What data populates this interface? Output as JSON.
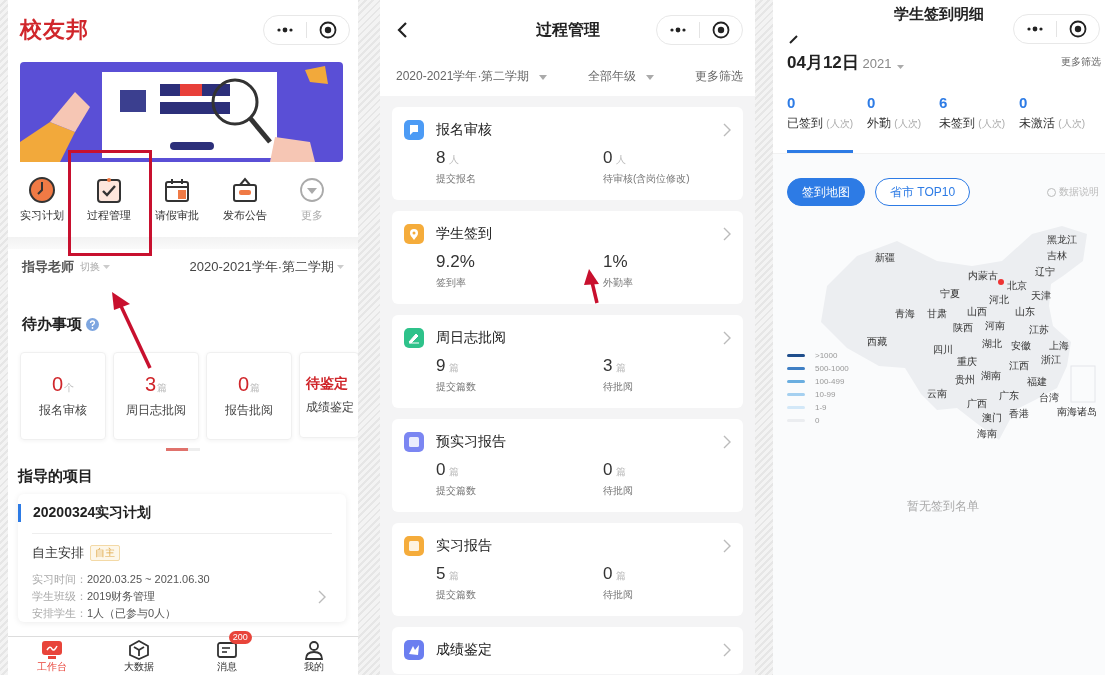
{
  "home": {
    "app_title": "校友邦",
    "shortcuts": [
      {
        "kind": "clock",
        "label": "实习计划",
        "disabled": false
      },
      {
        "kind": "check",
        "label": "过程管理",
        "disabled": false
      },
      {
        "kind": "calendar",
        "label": "请假审批",
        "disabled": false
      },
      {
        "kind": "board",
        "label": "发布公告",
        "disabled": false
      },
      {
        "kind": "more",
        "label": "更多",
        "disabled": true
      }
    ],
    "role": {
      "label": "指导老师",
      "switch": "切换"
    },
    "term": "2020-2021学年·第二学期",
    "todo": {
      "title": "待办事项",
      "cards": [
        {
          "value": "0",
          "unit": "个",
          "label": "报名审核"
        },
        {
          "value": "3",
          "unit": "篇",
          "label": "周日志批阅"
        },
        {
          "value": "0",
          "unit": "篇",
          "label": "报告批阅"
        },
        {
          "value": "待鉴定",
          "label": "成绩鉴定"
        }
      ]
    },
    "projects": {
      "title": "指导的项目",
      "card": {
        "title": "20200324实习计划",
        "mode": "自主安排",
        "tag": "自主",
        "details": [
          {
            "label": "实习时间：",
            "value": "2020.03.25 ~ 2021.06.30"
          },
          {
            "label": "学生班级：",
            "value": "2019财务管理"
          },
          {
            "label": "安排学生：",
            "value": "1人（已参与0人）"
          }
        ]
      }
    },
    "tab_bar": [
      {
        "kind": "desk",
        "label": "工作台",
        "selected": true
      },
      {
        "kind": "cube",
        "label": "大数据",
        "selected": false
      },
      {
        "kind": "message",
        "label": "消息",
        "selected": false,
        "badge": "200"
      },
      {
        "kind": "person",
        "label": "我的",
        "selected": false
      }
    ]
  },
  "process": {
    "title": "过程管理",
    "filters": [
      {
        "label": "2020-2021学年·第二学期",
        "dropdown": true
      },
      {
        "label": "全部年级",
        "dropdown": true
      },
      {
        "label": "更多筛选",
        "dropdown": false
      }
    ],
    "cards": [
      {
        "kind": "flag",
        "color": "#4c9bf5",
        "title": "报名审核",
        "stats": [
          {
            "value": "8",
            "unit": "人",
            "label": "提交报名"
          },
          {
            "value": "0",
            "unit": "人",
            "label": "待审核(含岗位修改)"
          }
        ]
      },
      {
        "kind": "pin",
        "color": "#f5ac3b",
        "title": "学生签到",
        "stats": [
          {
            "value": "9.2%",
            "label": "签到率"
          },
          {
            "value": "1%",
            "label": "外勤率"
          }
        ]
      },
      {
        "kind": "pen",
        "color": "#2ec28a",
        "title": "周日志批阅",
        "stats": [
          {
            "value": "9",
            "unit": "篇",
            "label": "提交篇数"
          },
          {
            "value": "3",
            "unit": "篇",
            "label": "待批阅"
          }
        ]
      },
      {
        "kind": "doc",
        "color": "#7b86f2",
        "title": "预实习报告",
        "stats": [
          {
            "value": "0",
            "unit": "篇",
            "label": "提交篇数"
          },
          {
            "value": "0",
            "unit": "篇",
            "label": "待批阅"
          }
        ]
      },
      {
        "kind": "doc",
        "color": "#f5ac3b",
        "title": "实习报告",
        "stats": [
          {
            "value": "5",
            "unit": "篇",
            "label": "提交篇数"
          },
          {
            "value": "0",
            "unit": "篇",
            "label": "待批阅"
          }
        ]
      },
      {
        "kind": "rank",
        "color": "#6b7ef0",
        "title": "成绩鉴定"
      }
    ]
  },
  "signin": {
    "title": "学生签到明细",
    "date": "04月12日",
    "year": "2021",
    "more_filter": "更多筛选",
    "stats": [
      {
        "value": "0",
        "label": "已签到",
        "unit": "(人次)",
        "selected": true
      },
      {
        "value": "0",
        "label": "外勤",
        "unit": "(人次)",
        "selected": false
      },
      {
        "value": "6",
        "label": "未签到",
        "unit": "(人次)",
        "selected": false
      },
      {
        "value": "0",
        "label": "未激活",
        "unit": "(人次)",
        "selected": false
      }
    ],
    "view_toggle": [
      {
        "label": "签到地图",
        "selected": true
      },
      {
        "label": "省市 TOP10",
        "selected": false
      }
    ],
    "help": "数据说明",
    "legend": [
      {
        "label": ">1000",
        "color": "#1f4e8c"
      },
      {
        "label": "500-1000",
        "color": "#3f7fc4"
      },
      {
        "label": "100-499",
        "color": "#6aaee0"
      },
      {
        "label": "10-99",
        "color": "#a5d0f0"
      },
      {
        "label": "1-9",
        "color": "#d3e8f8"
      },
      {
        "label": "0",
        "color": "#ebedf0"
      }
    ],
    "provinces": [
      "新疆",
      "黑龙江",
      "吉林",
      "辽宁",
      "内蒙古",
      "北京",
      "河北",
      "天津",
      "山西",
      "山东",
      "宁夏",
      "青海",
      "甘肃",
      "陕西",
      "河南",
      "江苏",
      "西藏",
      "四川",
      "湖北",
      "安徽",
      "上海",
      "重庆",
      "浙江",
      "江西",
      "湖南",
      "贵州",
      "云南",
      "福建",
      "台湾",
      "南海诸岛",
      "广东",
      "广西",
      "澳门",
      "香港",
      "海南"
    ],
    "empty": "暂无签到名单"
  }
}
